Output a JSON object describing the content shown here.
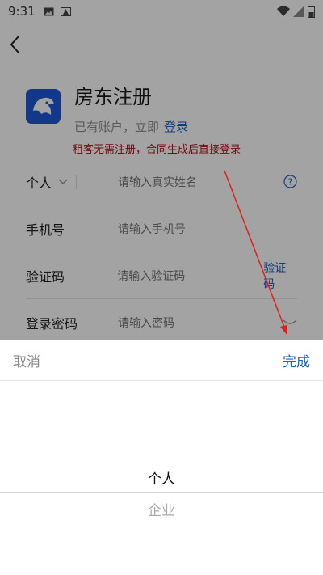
{
  "status_bar": {
    "time": "9:31"
  },
  "header": {
    "title": "房东注册",
    "subtitle_prefix": "已有账户，立即",
    "login_link": "登录",
    "note": "租客无需注册，合同生成后直接登录"
  },
  "form": {
    "type_select": {
      "value": "个人"
    },
    "name": {
      "placeholder": "请输入真实姓名"
    },
    "phone": {
      "label": "手机号",
      "placeholder": "请输入手机号"
    },
    "code": {
      "label": "验证码",
      "placeholder": "请输入验证码",
      "button": "验证码"
    },
    "password": {
      "label": "登录密码",
      "placeholder": "请输入密码"
    }
  },
  "picker": {
    "cancel": "取消",
    "done": "完成",
    "options": [
      "个人",
      "企业"
    ],
    "selected_index": 0
  },
  "colors": {
    "accent": "#1a62c4",
    "note": "#b3111a",
    "logo_bg": "#1f56d6",
    "arrow": "#e0201a"
  }
}
